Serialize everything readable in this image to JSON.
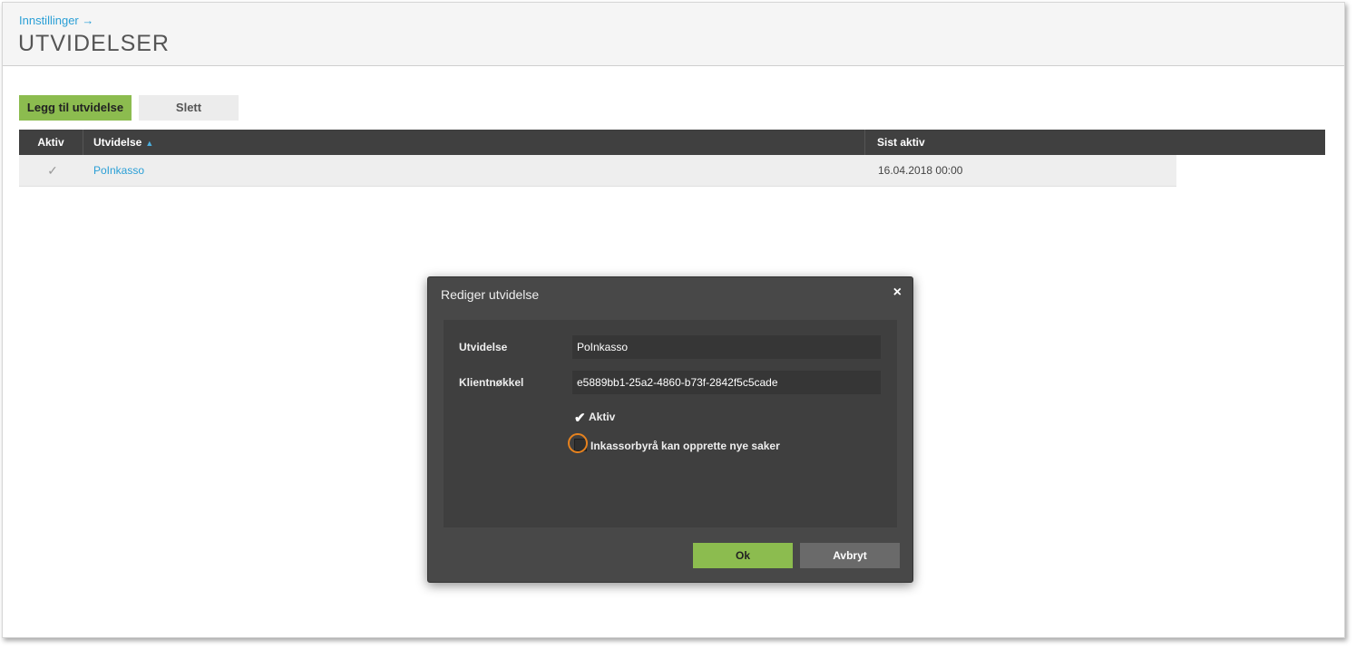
{
  "header": {
    "breadcrumb": "Innstillinger →",
    "title": "UTVIDELSER"
  },
  "toolbar": {
    "add_label": "Legg til utvidelse",
    "delete_label": "Slett"
  },
  "table": {
    "columns": [
      "Aktiv",
      "Utvidelse",
      "Sist aktiv"
    ],
    "sort_indicator": "▲",
    "rows": [
      {
        "active_icon": "✓",
        "name": "PoInkasso",
        "last_active": "16.04.2018 00:00"
      }
    ]
  },
  "modal": {
    "title": "Rediger utvidelse",
    "close_icon": "×",
    "fields": {
      "extension_label": "Utvidelse",
      "extension_value": "PoInkasso",
      "client_key_label": "Klientnøkkel",
      "client_key_value": "e5889bb1-25a2-4860-b73f-2842f5c5cade"
    },
    "checkboxes": {
      "active_label": "Aktiv",
      "active_checked": true,
      "agency_label": "Inkassorbyrå kan opprette nye saker",
      "agency_checked": false
    },
    "ok_label": "Ok",
    "cancel_label": "Avbryt"
  },
  "colors": {
    "accent_green": "#8cbc4f",
    "link_blue": "#2a9fd6",
    "focus_orange": "#e6821e"
  }
}
